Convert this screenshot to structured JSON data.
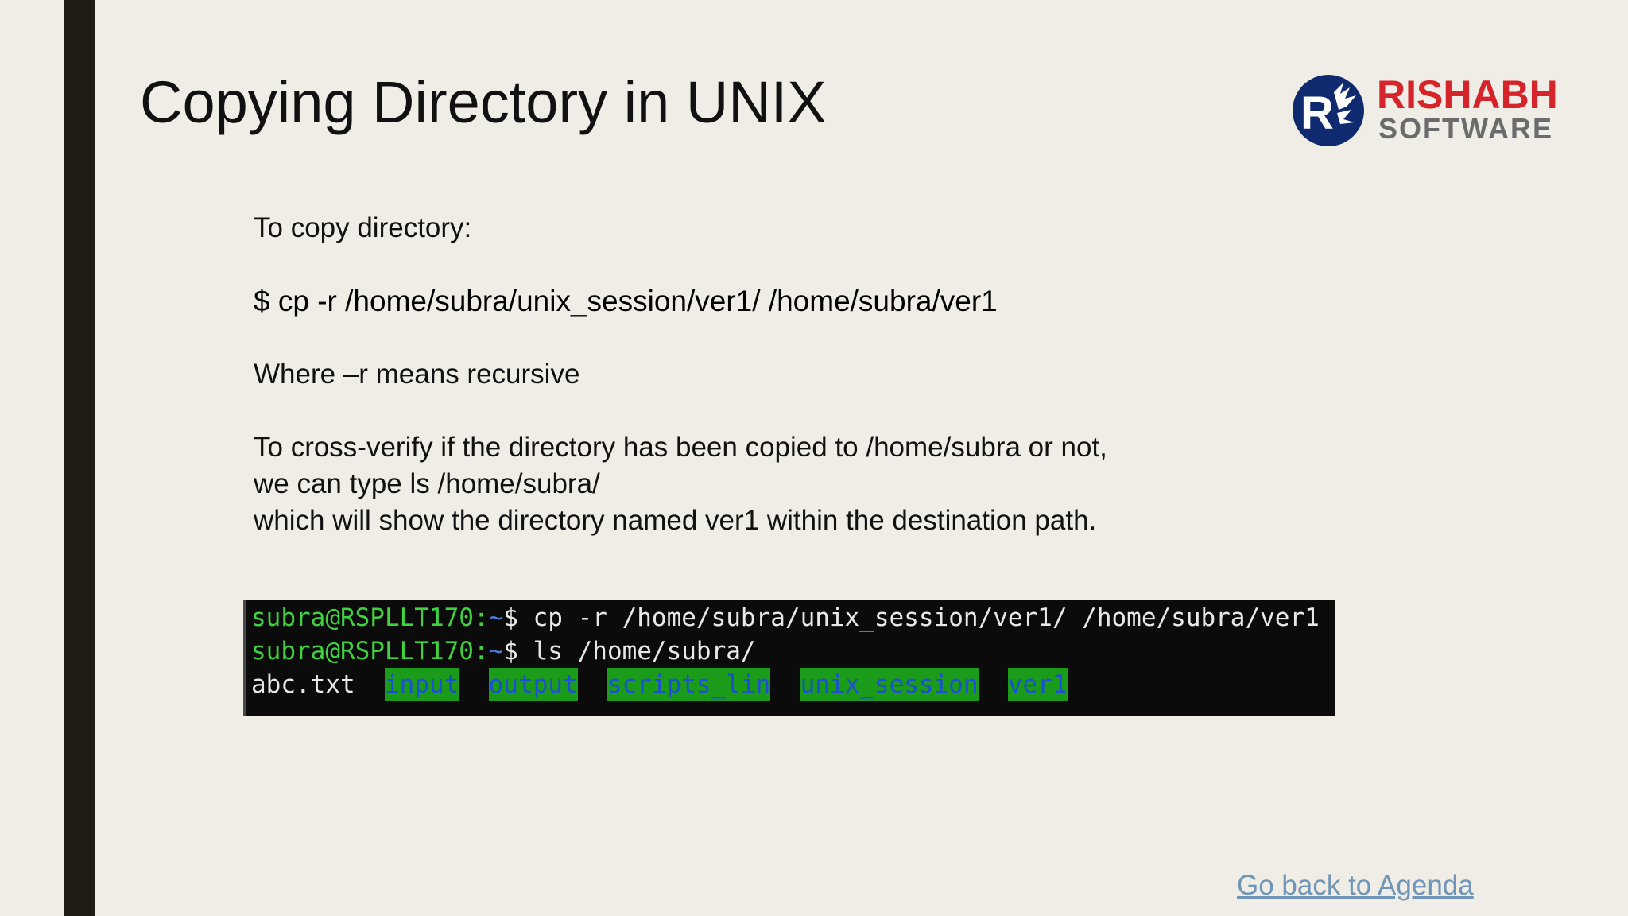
{
  "slide": {
    "title": "Copying Directory in UNIX"
  },
  "logo": {
    "name": "RISHABH",
    "sub": "SOFTWARE",
    "icon": "rishabh-logo-icon",
    "colors": {
      "circle": "#0f2a6e",
      "name": "#d6252a",
      "sub": "#6b6b6b"
    }
  },
  "content": {
    "intro": "To copy directory:",
    "command": "$ cp -r /home/subra/unix_session/ver1/ /home/subra/ver1",
    "where": "Where –r means recursive",
    "verify_line1": "To cross-verify if the directory has been copied to /home/subra or not,",
    "verify_line2": "we can type ls /home/subra/",
    "verify_line3": "which will show the directory named ver1 within the destination path."
  },
  "terminal": {
    "line1": {
      "user": "subra@RSPLLT170:",
      "tilde": "~",
      "command": "$ cp -r /home/subra/unix_session/ver1/ /home/subra/ver1"
    },
    "line2": {
      "user": "subra@RSPLLT170:",
      "tilde": "~",
      "command": "$ ls /home/subra/"
    },
    "line3": {
      "file": "abc.txt",
      "dirs": [
        "input",
        "output",
        "scripts_lin",
        "unix_session",
        "ver1"
      ]
    },
    "colors": {
      "background": "#0b0b0b",
      "user": "#3fd13f",
      "tilde": "#4f7bd9",
      "dir_bg": "#1a9c1a",
      "dir_fg": "#1d4fd6"
    }
  },
  "footer": {
    "link": "Go back to Agenda",
    "link_color": "#6f95b8"
  },
  "theme": {
    "background": "#efede6",
    "left_bar": "#1f1c14"
  }
}
